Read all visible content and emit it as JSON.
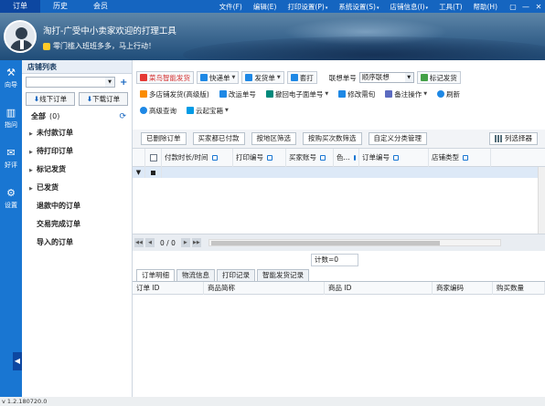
{
  "topbar": {
    "tabs": [
      "订单",
      "历史",
      "会员"
    ],
    "menu": [
      "文件(F)",
      "编辑(E)",
      "打印设置(P)",
      "系统设置(S)",
      "店铺信息(I)",
      "工具(T)",
      "帮助(H)"
    ],
    "menu_carets": [
      "",
      "",
      "▾",
      "▾",
      "▾",
      "",
      ""
    ],
    "window_controls": [
      "▢",
      "—",
      "✕"
    ]
  },
  "banner": {
    "welcome": "淘打-广受中小卖家欢迎的打理工具",
    "hint": "零门槛入班班多多，马上行动！"
  },
  "rail": {
    "items": [
      {
        "icon": "wrench-icon",
        "glyph": "⚒",
        "label": "向导"
      },
      {
        "icon": "chart-icon",
        "glyph": "▥",
        "label": "指问"
      },
      {
        "icon": "chat-icon",
        "glyph": "✉",
        "label": "好评"
      },
      {
        "icon": "gear-icon",
        "glyph": "⚙",
        "label": "设置"
      }
    ],
    "collapse": "◀"
  },
  "store": {
    "header": "店铺列表",
    "plus": "+",
    "offline_btn": "线下订单",
    "download_btn": "下载订单",
    "all_label": "全部",
    "all_count": "(0)",
    "refresh": "⟳",
    "tree": [
      {
        "label": "未付款订单",
        "toggle": "▶"
      },
      {
        "label": "待打印订单",
        "toggle": "▶"
      },
      {
        "label": "标记发货",
        "toggle": "▶"
      },
      {
        "label": "已发货",
        "toggle": "▶"
      },
      {
        "label": "退款中的订单",
        "toggle": ""
      },
      {
        "label": "交易完成订单",
        "toggle": ""
      },
      {
        "label": "导入的订单",
        "toggle": ""
      }
    ]
  },
  "toolbar": {
    "row1": {
      "smart_ship": "菜鸟智能发货",
      "quick_print": "快递单",
      "ship_print": "发货单",
      "batch_print": "套打",
      "link_label": "联想单号",
      "link_select": "顺序联想",
      "mark_ship": "标记发货"
    },
    "row2": {
      "multi_ship": "多店铺发货(高级版)",
      "change_no": "改运单号",
      "recover_eno": "撤回电子面单号",
      "edit_addr": "修改需旬",
      "remark_op": "备注操作",
      "refresh": "刷新"
    },
    "row3": {
      "adv_search": "高级查询",
      "cloud": "云起宝箱"
    }
  },
  "actions": [
    "已删除订单",
    "买家都已付款",
    "按地区筛选",
    "按购买次数筛选",
    "自定义分类管理"
  ],
  "column_selector": "列选择器",
  "grid": {
    "columns": [
      "付款时长/时间",
      "打印编号",
      "买家账号",
      "色...",
      "订单编号",
      "店铺类型"
    ],
    "filter_symbol": "▼"
  },
  "pager": {
    "first": "◀◀",
    "prev": "◀",
    "text": "0 / 0",
    "next": "▶",
    "last": "▶▶",
    "count": "计数=0"
  },
  "detail": {
    "tabs": [
      "订单明细",
      "物流信息",
      "打印记录",
      "智能发货记录"
    ],
    "columns": [
      "订单 ID",
      "商品简称",
      "商品 ID",
      "商家编码",
      "购买数量"
    ]
  },
  "status": "v 1.2.180720.0"
}
